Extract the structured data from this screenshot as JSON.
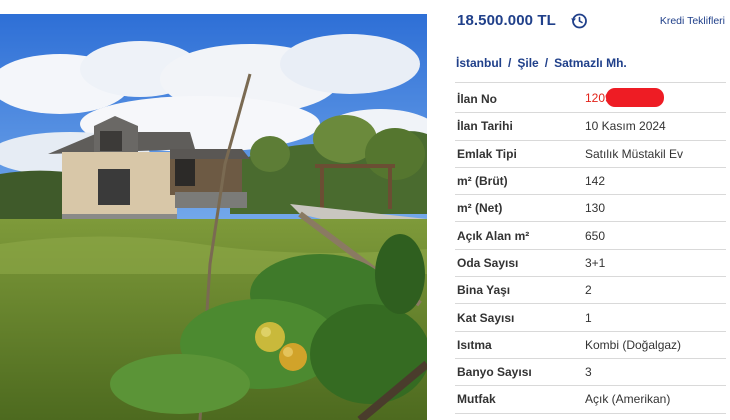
{
  "listing": {
    "price": "18.500.000 TL",
    "history_icon": "history-clock-icon",
    "credit_offers_label": "Kredi Teklifleri",
    "accent_color": "#20408a"
  },
  "breadcrumb": {
    "items": [
      "İstanbul",
      "Şile",
      "Satmazlı Mh."
    ],
    "separator": "/"
  },
  "details": {
    "rows": [
      {
        "label": "İlan No",
        "value": "1209"
      },
      {
        "label": "İlan Tarihi",
        "value": "10 Kasım 2024"
      },
      {
        "label": "Emlak Tipi",
        "value": "Satılık Müstakil Ev"
      },
      {
        "label": "m² (Brüt)",
        "value": "142"
      },
      {
        "label": "m² (Net)",
        "value": "130"
      },
      {
        "label": "Açık Alan m²",
        "value": "650"
      },
      {
        "label": "Oda Sayısı",
        "value": "3+1"
      },
      {
        "label": "Bina Yaşı",
        "value": "2"
      },
      {
        "label": "Kat Sayısı",
        "value": "1"
      },
      {
        "label": "Isıtma",
        "value": "Kombi (Doğalgaz)"
      },
      {
        "label": "Banyo Sayısı",
        "value": "3"
      },
      {
        "label": "Mutfak",
        "value": "Açık (Amerikan)"
      }
    ]
  }
}
